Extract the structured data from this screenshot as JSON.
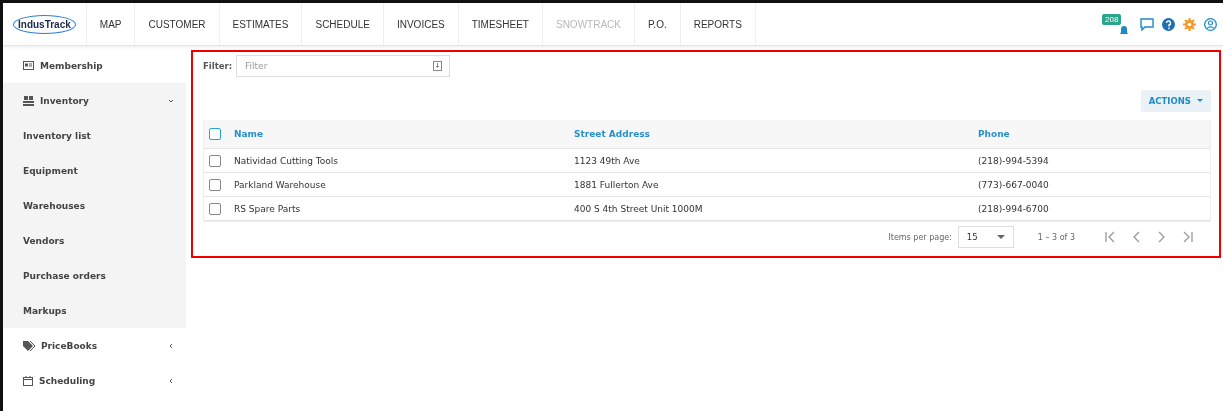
{
  "logo": "IndusTrack",
  "nav": [
    {
      "label": "MAP",
      "disabled": false
    },
    {
      "label": "CUSTOMER",
      "disabled": false
    },
    {
      "label": "ESTIMATES",
      "disabled": false
    },
    {
      "label": "SCHEDULE",
      "disabled": false
    },
    {
      "label": "INVOICES",
      "disabled": false
    },
    {
      "label": "TIMESHEET",
      "disabled": false
    },
    {
      "label": "SNOWTRACK",
      "disabled": true
    },
    {
      "label": "P.O.",
      "disabled": false
    },
    {
      "label": "REPORTS",
      "disabled": false
    }
  ],
  "notifications": {
    "count": "208"
  },
  "sidebar": {
    "items": [
      {
        "label": "Membership"
      },
      {
        "label": "Inventory",
        "expanded": true,
        "children": [
          {
            "label": "Inventory list"
          },
          {
            "label": "Equipment"
          },
          {
            "label": "Warehouses"
          },
          {
            "label": "Vendors"
          },
          {
            "label": "Purchase orders"
          },
          {
            "label": "Markups"
          }
        ]
      },
      {
        "label": "PriceBooks",
        "expanded": false
      },
      {
        "label": "Scheduling",
        "expanded": false
      }
    ]
  },
  "filter": {
    "label": "Filter:",
    "placeholder": "Filter"
  },
  "actions_button": "ACTIONS",
  "table": {
    "select_all": false,
    "columns": [
      "Name",
      "Street Address",
      "Phone"
    ],
    "rows": [
      {
        "checked": false,
        "cells": [
          "Natividad Cutting Tools",
          "1123 49th Ave",
          "(218)-994-5394"
        ]
      },
      {
        "checked": false,
        "cells": [
          "Parkland Warehouse",
          "1881 Fullerton Ave",
          "(773)-667-0040"
        ]
      },
      {
        "checked": false,
        "cells": [
          "RS Spare Parts",
          "400 S 4th Street Unit 1000M",
          "(218)-994-6700"
        ]
      }
    ]
  },
  "paginator": {
    "label": "Items per page:",
    "page_size": "15",
    "range": "1 – 3 of 3"
  }
}
